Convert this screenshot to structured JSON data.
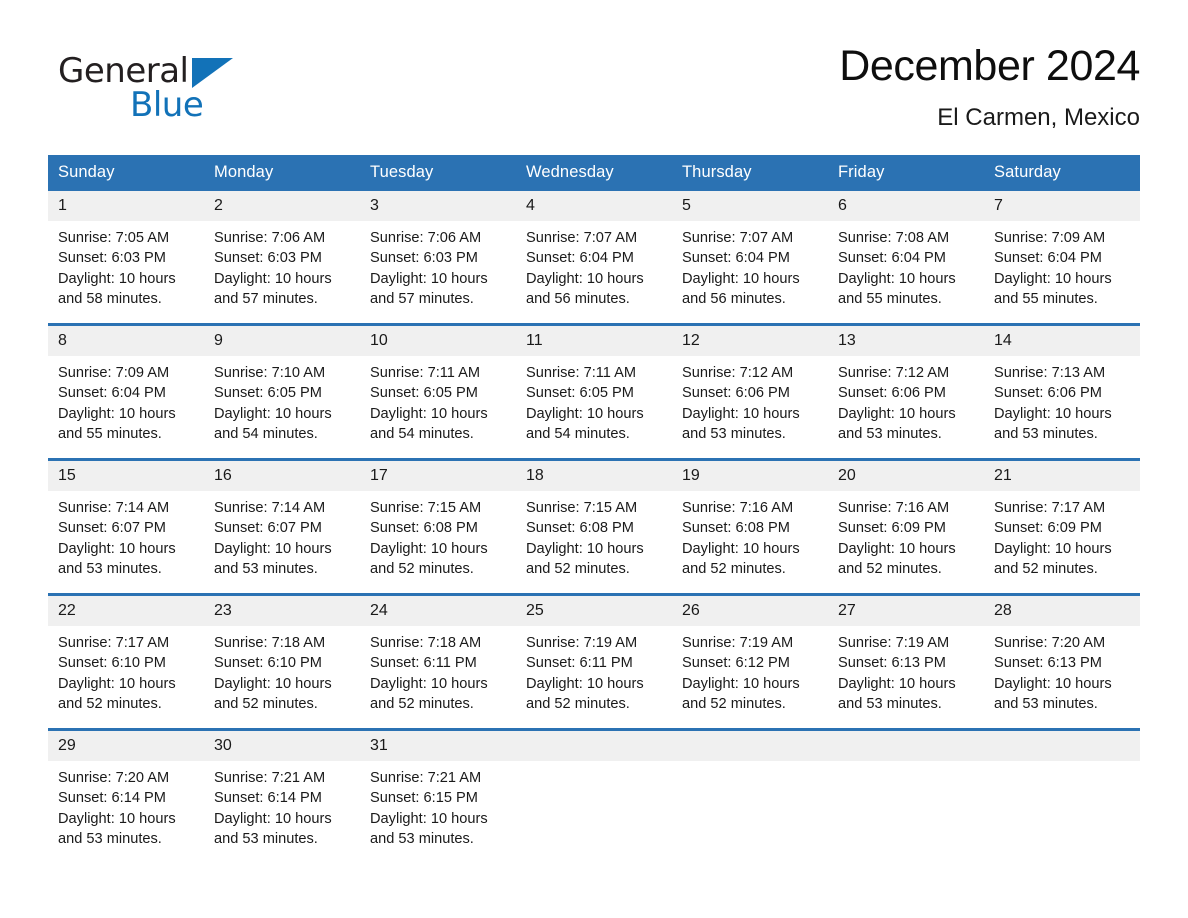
{
  "brand": {
    "name_part1": "General",
    "name_part2": "Blue",
    "triangle_color": "#1272b8"
  },
  "header": {
    "month_title": "December 2024",
    "location": "El Carmen, Mexico"
  },
  "colors": {
    "header_blue": "#2b72b3",
    "daynum_band": "#f0f0f0",
    "brand_blue": "#1272b8",
    "text": "#1a1a1a"
  },
  "weekday_headers": [
    "Sunday",
    "Monday",
    "Tuesday",
    "Wednesday",
    "Thursday",
    "Friday",
    "Saturday"
  ],
  "weeks": [
    [
      {
        "day": "1",
        "details": "Sunrise: 7:05 AM\nSunset: 6:03 PM\nDaylight: 10 hours and 58 minutes."
      },
      {
        "day": "2",
        "details": "Sunrise: 7:06 AM\nSunset: 6:03 PM\nDaylight: 10 hours and 57 minutes."
      },
      {
        "day": "3",
        "details": "Sunrise: 7:06 AM\nSunset: 6:03 PM\nDaylight: 10 hours and 57 minutes."
      },
      {
        "day": "4",
        "details": "Sunrise: 7:07 AM\nSunset: 6:04 PM\nDaylight: 10 hours and 56 minutes."
      },
      {
        "day": "5",
        "details": "Sunrise: 7:07 AM\nSunset: 6:04 PM\nDaylight: 10 hours and 56 minutes."
      },
      {
        "day": "6",
        "details": "Sunrise: 7:08 AM\nSunset: 6:04 PM\nDaylight: 10 hours and 55 minutes."
      },
      {
        "day": "7",
        "details": "Sunrise: 7:09 AM\nSunset: 6:04 PM\nDaylight: 10 hours and 55 minutes."
      }
    ],
    [
      {
        "day": "8",
        "details": "Sunrise: 7:09 AM\nSunset: 6:04 PM\nDaylight: 10 hours and 55 minutes."
      },
      {
        "day": "9",
        "details": "Sunrise: 7:10 AM\nSunset: 6:05 PM\nDaylight: 10 hours and 54 minutes."
      },
      {
        "day": "10",
        "details": "Sunrise: 7:11 AM\nSunset: 6:05 PM\nDaylight: 10 hours and 54 minutes."
      },
      {
        "day": "11",
        "details": "Sunrise: 7:11 AM\nSunset: 6:05 PM\nDaylight: 10 hours and 54 minutes."
      },
      {
        "day": "12",
        "details": "Sunrise: 7:12 AM\nSunset: 6:06 PM\nDaylight: 10 hours and 53 minutes."
      },
      {
        "day": "13",
        "details": "Sunrise: 7:12 AM\nSunset: 6:06 PM\nDaylight: 10 hours and 53 minutes."
      },
      {
        "day": "14",
        "details": "Sunrise: 7:13 AM\nSunset: 6:06 PM\nDaylight: 10 hours and 53 minutes."
      }
    ],
    [
      {
        "day": "15",
        "details": "Sunrise: 7:14 AM\nSunset: 6:07 PM\nDaylight: 10 hours and 53 minutes."
      },
      {
        "day": "16",
        "details": "Sunrise: 7:14 AM\nSunset: 6:07 PM\nDaylight: 10 hours and 53 minutes."
      },
      {
        "day": "17",
        "details": "Sunrise: 7:15 AM\nSunset: 6:08 PM\nDaylight: 10 hours and 52 minutes."
      },
      {
        "day": "18",
        "details": "Sunrise: 7:15 AM\nSunset: 6:08 PM\nDaylight: 10 hours and 52 minutes."
      },
      {
        "day": "19",
        "details": "Sunrise: 7:16 AM\nSunset: 6:08 PM\nDaylight: 10 hours and 52 minutes."
      },
      {
        "day": "20",
        "details": "Sunrise: 7:16 AM\nSunset: 6:09 PM\nDaylight: 10 hours and 52 minutes."
      },
      {
        "day": "21",
        "details": "Sunrise: 7:17 AM\nSunset: 6:09 PM\nDaylight: 10 hours and 52 minutes."
      }
    ],
    [
      {
        "day": "22",
        "details": "Sunrise: 7:17 AM\nSunset: 6:10 PM\nDaylight: 10 hours and 52 minutes."
      },
      {
        "day": "23",
        "details": "Sunrise: 7:18 AM\nSunset: 6:10 PM\nDaylight: 10 hours and 52 minutes."
      },
      {
        "day": "24",
        "details": "Sunrise: 7:18 AM\nSunset: 6:11 PM\nDaylight: 10 hours and 52 minutes."
      },
      {
        "day": "25",
        "details": "Sunrise: 7:19 AM\nSunset: 6:11 PM\nDaylight: 10 hours and 52 minutes."
      },
      {
        "day": "26",
        "details": "Sunrise: 7:19 AM\nSunset: 6:12 PM\nDaylight: 10 hours and 52 minutes."
      },
      {
        "day": "27",
        "details": "Sunrise: 7:19 AM\nSunset: 6:13 PM\nDaylight: 10 hours and 53 minutes."
      },
      {
        "day": "28",
        "details": "Sunrise: 7:20 AM\nSunset: 6:13 PM\nDaylight: 10 hours and 53 minutes."
      }
    ],
    [
      {
        "day": "29",
        "details": "Sunrise: 7:20 AM\nSunset: 6:14 PM\nDaylight: 10 hours and 53 minutes."
      },
      {
        "day": "30",
        "details": "Sunrise: 7:21 AM\nSunset: 6:14 PM\nDaylight: 10 hours and 53 minutes."
      },
      {
        "day": "31",
        "details": "Sunrise: 7:21 AM\nSunset: 6:15 PM\nDaylight: 10 hours and 53 minutes."
      },
      {
        "day": "",
        "details": ""
      },
      {
        "day": "",
        "details": ""
      },
      {
        "day": "",
        "details": ""
      },
      {
        "day": "",
        "details": ""
      }
    ]
  ]
}
